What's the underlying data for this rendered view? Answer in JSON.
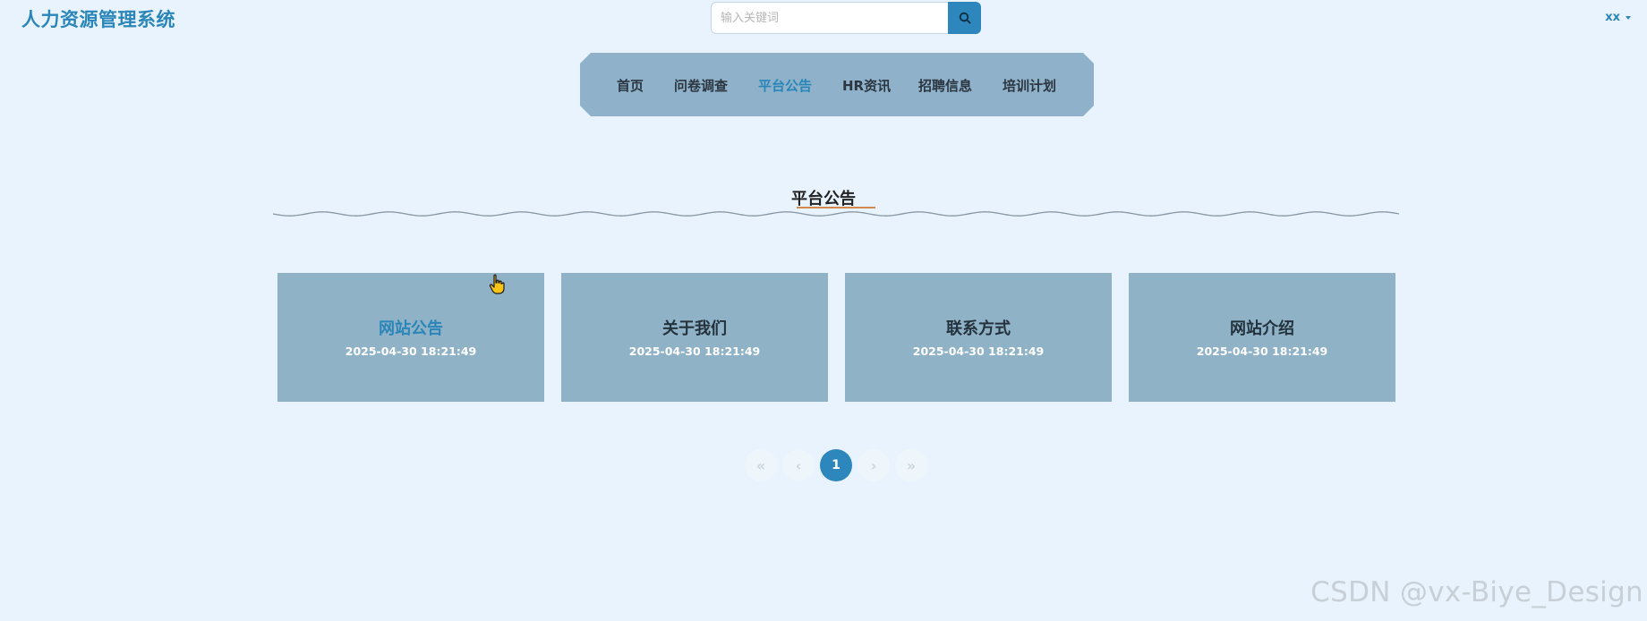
{
  "header": {
    "site_title": "人力资源管理系统",
    "search": {
      "placeholder": "输入关键词",
      "value": ""
    },
    "user": {
      "name": "xx"
    }
  },
  "nav": {
    "items": [
      {
        "label": "首页",
        "active": false
      },
      {
        "label": "问卷调查",
        "active": false
      },
      {
        "label": "平台公告",
        "active": true
      },
      {
        "label": "HR资讯",
        "active": false
      },
      {
        "label": "招聘信息",
        "active": false
      },
      {
        "label": "培训计划",
        "active": false
      }
    ]
  },
  "section": {
    "title": "平台公告"
  },
  "cards": [
    {
      "title": "网站公告",
      "date": "2025-04-30 18:21:49"
    },
    {
      "title": "关于我们",
      "date": "2025-04-30 18:21:49"
    },
    {
      "title": "联系方式",
      "date": "2025-04-30 18:21:49"
    },
    {
      "title": "网站介绍",
      "date": "2025-04-30 18:21:49"
    }
  ],
  "pagination": {
    "first": "«",
    "prev": "‹",
    "current": "1",
    "next": "›",
    "last": "»"
  },
  "watermark": "CSDN @vx-Biye_Design",
  "colors": {
    "background": "#e8f3fd",
    "accent": "#2a86b8",
    "nav_bg": "#8fb2ca",
    "card_bg": "#90b2c7"
  },
  "icons": {
    "search": "search-icon",
    "caret": "caret-down-icon",
    "cursor": "hand-pointer-cursor-icon"
  }
}
